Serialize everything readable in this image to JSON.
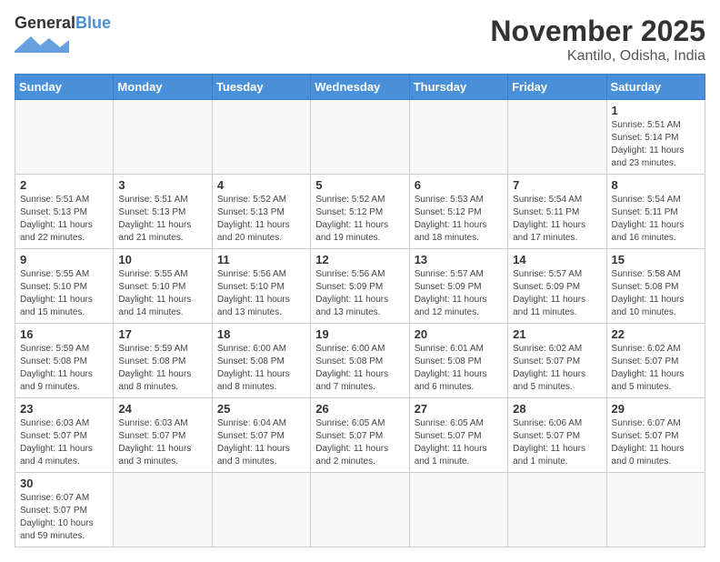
{
  "logo": {
    "general": "General",
    "blue": "Blue"
  },
  "title": "November 2025",
  "location": "Kantilo, Odisha, India",
  "weekdays": [
    "Sunday",
    "Monday",
    "Tuesday",
    "Wednesday",
    "Thursday",
    "Friday",
    "Saturday"
  ],
  "days": {
    "1": {
      "sunrise": "5:51 AM",
      "sunset": "5:14 PM",
      "daylight": "11 hours and 23 minutes."
    },
    "2": {
      "sunrise": "5:51 AM",
      "sunset": "5:13 PM",
      "daylight": "11 hours and 22 minutes."
    },
    "3": {
      "sunrise": "5:51 AM",
      "sunset": "5:13 PM",
      "daylight": "11 hours and 21 minutes."
    },
    "4": {
      "sunrise": "5:52 AM",
      "sunset": "5:13 PM",
      "daylight": "11 hours and 20 minutes."
    },
    "5": {
      "sunrise": "5:52 AM",
      "sunset": "5:12 PM",
      "daylight": "11 hours and 19 minutes."
    },
    "6": {
      "sunrise": "5:53 AM",
      "sunset": "5:12 PM",
      "daylight": "11 hours and 18 minutes."
    },
    "7": {
      "sunrise": "5:54 AM",
      "sunset": "5:11 PM",
      "daylight": "11 hours and 17 minutes."
    },
    "8": {
      "sunrise": "5:54 AM",
      "sunset": "5:11 PM",
      "daylight": "11 hours and 16 minutes."
    },
    "9": {
      "sunrise": "5:55 AM",
      "sunset": "5:10 PM",
      "daylight": "11 hours and 15 minutes."
    },
    "10": {
      "sunrise": "5:55 AM",
      "sunset": "5:10 PM",
      "daylight": "11 hours and 14 minutes."
    },
    "11": {
      "sunrise": "5:56 AM",
      "sunset": "5:10 PM",
      "daylight": "11 hours and 13 minutes."
    },
    "12": {
      "sunrise": "5:56 AM",
      "sunset": "5:09 PM",
      "daylight": "11 hours and 13 minutes."
    },
    "13": {
      "sunrise": "5:57 AM",
      "sunset": "5:09 PM",
      "daylight": "11 hours and 12 minutes."
    },
    "14": {
      "sunrise": "5:57 AM",
      "sunset": "5:09 PM",
      "daylight": "11 hours and 11 minutes."
    },
    "15": {
      "sunrise": "5:58 AM",
      "sunset": "5:08 PM",
      "daylight": "11 hours and 10 minutes."
    },
    "16": {
      "sunrise": "5:59 AM",
      "sunset": "5:08 PM",
      "daylight": "11 hours and 9 minutes."
    },
    "17": {
      "sunrise": "5:59 AM",
      "sunset": "5:08 PM",
      "daylight": "11 hours and 8 minutes."
    },
    "18": {
      "sunrise": "6:00 AM",
      "sunset": "5:08 PM",
      "daylight": "11 hours and 8 minutes."
    },
    "19": {
      "sunrise": "6:00 AM",
      "sunset": "5:08 PM",
      "daylight": "11 hours and 7 minutes."
    },
    "20": {
      "sunrise": "6:01 AM",
      "sunset": "5:08 PM",
      "daylight": "11 hours and 6 minutes."
    },
    "21": {
      "sunrise": "6:02 AM",
      "sunset": "5:07 PM",
      "daylight": "11 hours and 5 minutes."
    },
    "22": {
      "sunrise": "6:02 AM",
      "sunset": "5:07 PM",
      "daylight": "11 hours and 5 minutes."
    },
    "23": {
      "sunrise": "6:03 AM",
      "sunset": "5:07 PM",
      "daylight": "11 hours and 4 minutes."
    },
    "24": {
      "sunrise": "6:03 AM",
      "sunset": "5:07 PM",
      "daylight": "11 hours and 3 minutes."
    },
    "25": {
      "sunrise": "6:04 AM",
      "sunset": "5:07 PM",
      "daylight": "11 hours and 3 minutes."
    },
    "26": {
      "sunrise": "6:05 AM",
      "sunset": "5:07 PM",
      "daylight": "11 hours and 2 minutes."
    },
    "27": {
      "sunrise": "6:05 AM",
      "sunset": "5:07 PM",
      "daylight": "11 hours and 1 minute."
    },
    "28": {
      "sunrise": "6:06 AM",
      "sunset": "5:07 PM",
      "daylight": "11 hours and 1 minute."
    },
    "29": {
      "sunrise": "6:07 AM",
      "sunset": "5:07 PM",
      "daylight": "11 hours and 0 minutes."
    },
    "30": {
      "sunrise": "6:07 AM",
      "sunset": "5:07 PM",
      "daylight": "10 hours and 59 minutes."
    }
  },
  "labels": {
    "sunrise": "Sunrise:",
    "sunset": "Sunset:",
    "daylight": "Daylight:"
  }
}
